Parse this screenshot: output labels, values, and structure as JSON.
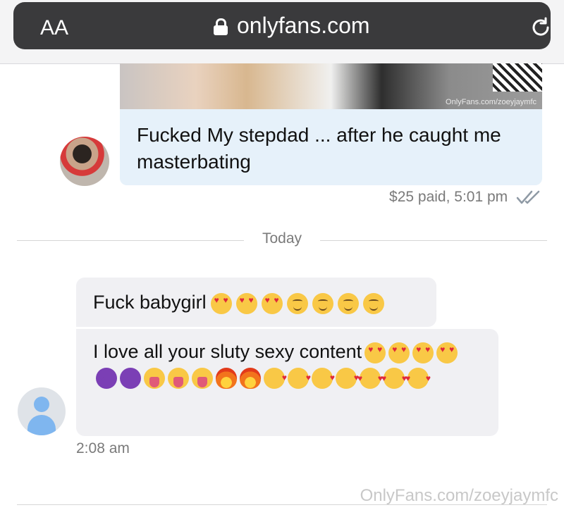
{
  "browser": {
    "text_size_label": "AA",
    "domain": "onlyfans.com",
    "lock_icon": "lock-icon",
    "reload_icon": "reload-icon"
  },
  "chat": {
    "media_watermark": "OnlyFans.com/zoeyjaymfc",
    "paid_message": {
      "text": "Fucked My stepdad ... after he caught me masterbating",
      "meta": "$25 paid, 5:01 pm",
      "status_icon": "double-check-icon"
    },
    "date_separator": "Today",
    "received": [
      {
        "text": "Fuck babygirl",
        "emojis": [
          "heart-eyes",
          "heart-eyes",
          "heart-eyes",
          "drooling",
          "drooling",
          "drooling",
          "drooling"
        ]
      },
      {
        "text": "I love all your sluty sexy content",
        "emojis": [
          "heart-eyes",
          "heart-eyes",
          "heart-eyes",
          "heart-eyes",
          "smiling-devil",
          "smiling-devil",
          "tongue",
          "tongue",
          "tongue",
          "fire",
          "fire",
          "blowing-kiss",
          "blowing-kiss",
          "blowing-kiss",
          "blowing-kiss",
          "smiling-hearts",
          "smiling-hearts",
          "smiling-hearts"
        ]
      }
    ],
    "received_time": "2:08 am",
    "page_watermark": "OnlyFans.com/zoeyjaymfc"
  },
  "colors": {
    "url_bar": "#3a3a3c",
    "sent_bubble": "#e6f1fa",
    "received_bubble": "#f0f0f3",
    "default_avatar": "#7fb6ef"
  }
}
